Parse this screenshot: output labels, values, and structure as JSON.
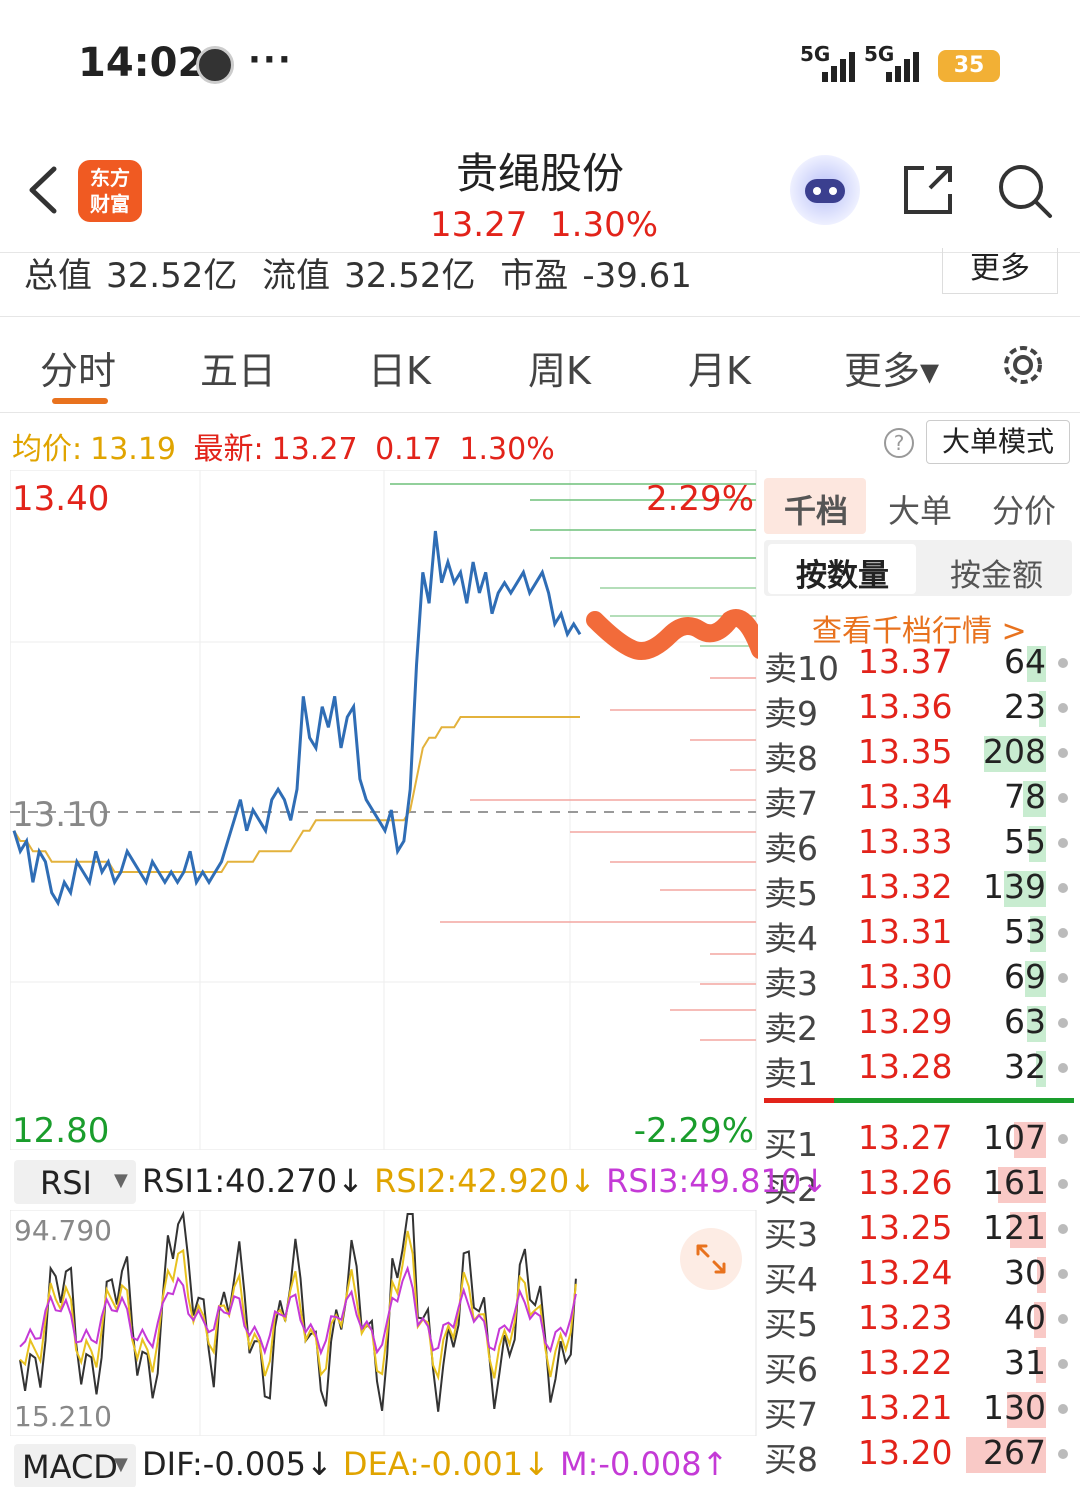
{
  "status_bar": {
    "time": "14:02",
    "dots": "···",
    "signal1": "5G",
    "signal2": "5G",
    "battery": "35"
  },
  "header": {
    "app_logo_line1": "东方",
    "app_logo_line2": "财富",
    "stock_name": "贵绳股份",
    "price": "13.27",
    "change_pct": "1.30%"
  },
  "metrics": {
    "total_value_label": "总值",
    "total_value": "32.52亿",
    "float_value_label": "流值",
    "float_value": "32.52亿",
    "pe_label": "市盈",
    "pe_value": "-39.61",
    "more_label": "更多"
  },
  "tabs": [
    {
      "label": "分时",
      "active": true
    },
    {
      "label": "五日",
      "active": false
    },
    {
      "label": "日K",
      "active": false
    },
    {
      "label": "周K",
      "active": false
    },
    {
      "label": "月K",
      "active": false
    },
    {
      "label": "更多▾",
      "active": false
    }
  ],
  "info": {
    "avg_label": "均价:",
    "avg_value": "13.19",
    "latest_label": "最新:",
    "latest_value": "13.27",
    "change": "0.17",
    "change_pct": "1.30%",
    "help": "?",
    "mode_button": "大单模式"
  },
  "chart_data": {
    "type": "line",
    "y_top_label": "13.40",
    "y_mid_label": "13.10",
    "y_bottom_label": "12.80",
    "pct_top_label": "2.29%",
    "pct_bottom_label": "-2.29%",
    "ylim": [
      12.8,
      13.4
    ],
    "prev_close": 13.1,
    "series": [
      {
        "color": "#2f6db5",
        "values": [
          13.08,
          13.06,
          13.07,
          13.03,
          13.06,
          13.05,
          13.02,
          13.01,
          13.03,
          13.02,
          13.05,
          13.04,
          13.03,
          13.06,
          13.04,
          13.05,
          13.03,
          13.04,
          13.06,
          13.05,
          13.04,
          13.03,
          13.05,
          13.04,
          13.03,
          13.04,
          13.03,
          13.04,
          13.06,
          13.03,
          13.04,
          13.03,
          13.04,
          13.05,
          13.07,
          13.09,
          13.11,
          13.08,
          13.1,
          13.09,
          13.08,
          13.11,
          13.12,
          13.11,
          13.09,
          13.12,
          13.21,
          13.17,
          13.16,
          13.2,
          13.18,
          13.21,
          13.16,
          13.19,
          13.2,
          13.13,
          13.11,
          13.1,
          13.09,
          13.08,
          13.1,
          13.06,
          13.07,
          13.12,
          13.24,
          13.33,
          13.3,
          13.37,
          13.32,
          13.34,
          13.32,
          13.33,
          13.3,
          13.34,
          13.31,
          13.33,
          13.29,
          13.31,
          13.32,
          13.31,
          13.32,
          13.33,
          13.31,
          13.32,
          13.33,
          13.31,
          13.28,
          13.29,
          13.27,
          13.28,
          13.27
        ]
      },
      {
        "color": "#e3b23c",
        "values": [
          13.08,
          13.07,
          13.07,
          13.06,
          13.06,
          13.06,
          13.05,
          13.05,
          13.05,
          13.05,
          13.05,
          13.05,
          13.05,
          13.05,
          13.05,
          13.05,
          13.04,
          13.04,
          13.04,
          13.04,
          13.04,
          13.04,
          13.04,
          13.04,
          13.04,
          13.04,
          13.04,
          13.04,
          13.04,
          13.04,
          13.04,
          13.04,
          13.04,
          13.04,
          13.05,
          13.05,
          13.05,
          13.05,
          13.05,
          13.06,
          13.06,
          13.06,
          13.06,
          13.06,
          13.06,
          13.07,
          13.08,
          13.08,
          13.09,
          13.09,
          13.09,
          13.09,
          13.09,
          13.09,
          13.09,
          13.09,
          13.09,
          13.09,
          13.09,
          13.09,
          13.09,
          13.09,
          13.09,
          13.1,
          13.13,
          13.16,
          13.17,
          13.17,
          13.18,
          13.18,
          13.18,
          13.19,
          13.19,
          13.19,
          13.19,
          13.19,
          13.19,
          13.19,
          13.19,
          13.19,
          13.19,
          13.19,
          13.19,
          13.19,
          13.19,
          13.19,
          13.19,
          13.19,
          13.19,
          13.19,
          13.19
        ]
      }
    ]
  },
  "order_book": {
    "tabs": [
      "千档",
      "大单",
      "分价"
    ],
    "sub_tabs": [
      "按数量",
      "按金额"
    ],
    "link": "查看千档行情 >",
    "asks": [
      {
        "level": "卖10",
        "price": "13.37",
        "vol": "64",
        "share": 0.24
      },
      {
        "level": "卖9",
        "price": "13.36",
        "vol": "23",
        "share": 0.09
      },
      {
        "level": "卖8",
        "price": "13.35",
        "vol": "208",
        "share": 0.78
      },
      {
        "level": "卖7",
        "price": "13.34",
        "vol": "78",
        "share": 0.29
      },
      {
        "level": "卖6",
        "price": "13.33",
        "vol": "55",
        "share": 0.21
      },
      {
        "level": "卖5",
        "price": "13.32",
        "vol": "139",
        "share": 0.52
      },
      {
        "level": "卖4",
        "price": "13.31",
        "vol": "53",
        "share": 0.2
      },
      {
        "level": "卖3",
        "price": "13.30",
        "vol": "69",
        "share": 0.26
      },
      {
        "level": "卖2",
        "price": "13.29",
        "vol": "63",
        "share": 0.24
      },
      {
        "level": "卖1",
        "price": "13.28",
        "vol": "32",
        "share": 0.12
      }
    ],
    "bids": [
      {
        "level": "买1",
        "price": "13.27",
        "vol": "107",
        "share": 0.4
      },
      {
        "level": "买2",
        "price": "13.26",
        "vol": "161",
        "share": 0.6
      },
      {
        "level": "买3",
        "price": "13.25",
        "vol": "121",
        "share": 0.45
      },
      {
        "level": "买4",
        "price": "13.24",
        "vol": "30",
        "share": 0.11
      },
      {
        "level": "买5",
        "price": "13.23",
        "vol": "40",
        "share": 0.15
      },
      {
        "level": "买6",
        "price": "13.22",
        "vol": "31",
        "share": 0.12
      },
      {
        "level": "买7",
        "price": "13.21",
        "vol": "130",
        "share": 0.49
      },
      {
        "level": "买8",
        "price": "13.20",
        "vol": "267",
        "share": 1.0
      }
    ]
  },
  "rsi": {
    "selector": "RSI",
    "rsi1": "RSI1:40.270↓",
    "rsi2": "RSI2:42.920↓",
    "rsi3": "RSI3:49.810↓",
    "top_label": "94.790",
    "bottom_label": "15.210"
  },
  "macd": {
    "selector": "MACD",
    "dif": "DIF:-0.005↓",
    "dea": "DEA:-0.001↓",
    "m": "M:-0.008↑"
  },
  "colors": {
    "up": "#e2231a",
    "down": "#1a9d2c",
    "accent": "#e8721e",
    "price_line": "#2f6db5",
    "avg_line": "#e3b23c"
  }
}
